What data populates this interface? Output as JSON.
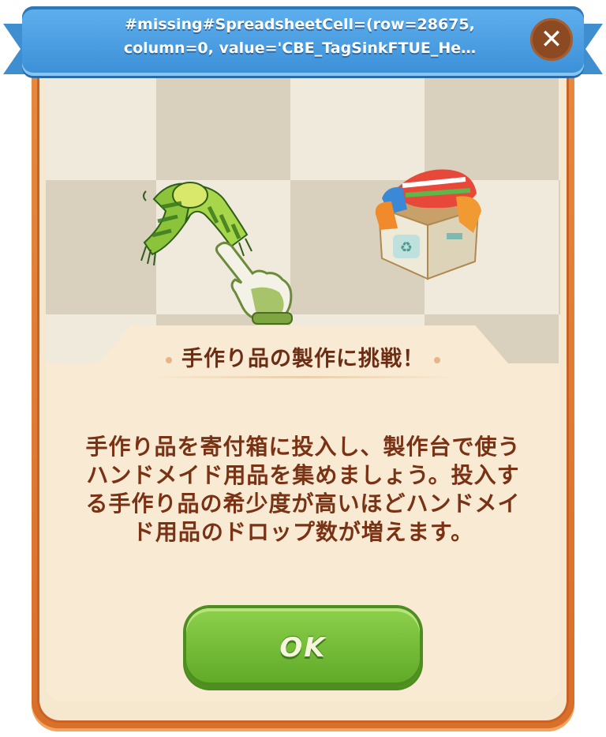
{
  "dialog": {
    "title": "#missing#SpreadsheetCell=(row=28675,\ncolumn=0, value='CBE_TagSinkFTUE_He…",
    "close_icon": "close-icon",
    "heading": "手作り品の製作に挑戦！",
    "body": "手作り品を寄付箱に投入し、製作台で使うハンドメイド用品を集めましょう。投入する手作り品の希少度が高いほどハンドメイド用品のドロップ数が増えます。",
    "ok_label": "OK"
  },
  "colors": {
    "ribbon": "#3b8fd6",
    "frame": "#d86f2a",
    "ok_button": "#6cb630",
    "text": "#7a3214"
  },
  "illustration": {
    "left_item": "striped-scarf-icon",
    "pointer": "pointing-hand-icon",
    "right_item": "donation-box-icon"
  }
}
